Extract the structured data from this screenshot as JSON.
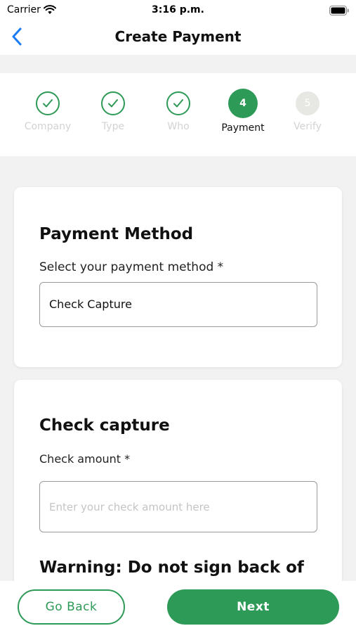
{
  "status_bar": {
    "carrier": "Carrier",
    "time": "3:16 p.m.",
    "icons": [
      "wifi-icon",
      "battery-icon"
    ]
  },
  "nav": {
    "title": "Create Payment",
    "back_icon": "chevron-left-icon"
  },
  "stepper": {
    "steps": [
      {
        "label": "Company",
        "state": "done",
        "icon": "check-icon"
      },
      {
        "label": "Type",
        "state": "done",
        "icon": "check-icon"
      },
      {
        "label": "Who",
        "state": "done",
        "icon": "check-icon"
      },
      {
        "label": "Payment",
        "state": "current",
        "number": "4"
      },
      {
        "label": "Verify",
        "state": "pending",
        "number": "5"
      }
    ]
  },
  "payment_method": {
    "title": "Payment Method",
    "label": "Select your payment method *",
    "value": "Check Capture"
  },
  "check_capture": {
    "title": "Check capture",
    "amount_label": "Check amount *",
    "amount_placeholder": "Enter your check amount here",
    "amount_value": "",
    "warning": "Warning: Do not sign back of"
  },
  "actions": {
    "back_label": "Go Back",
    "next_label": "Next"
  },
  "colors": {
    "accent": "#2e9a57",
    "link_blue": "#1a7cf5",
    "background": "#f2f2f2",
    "pending_step": "#e7e7e4"
  }
}
